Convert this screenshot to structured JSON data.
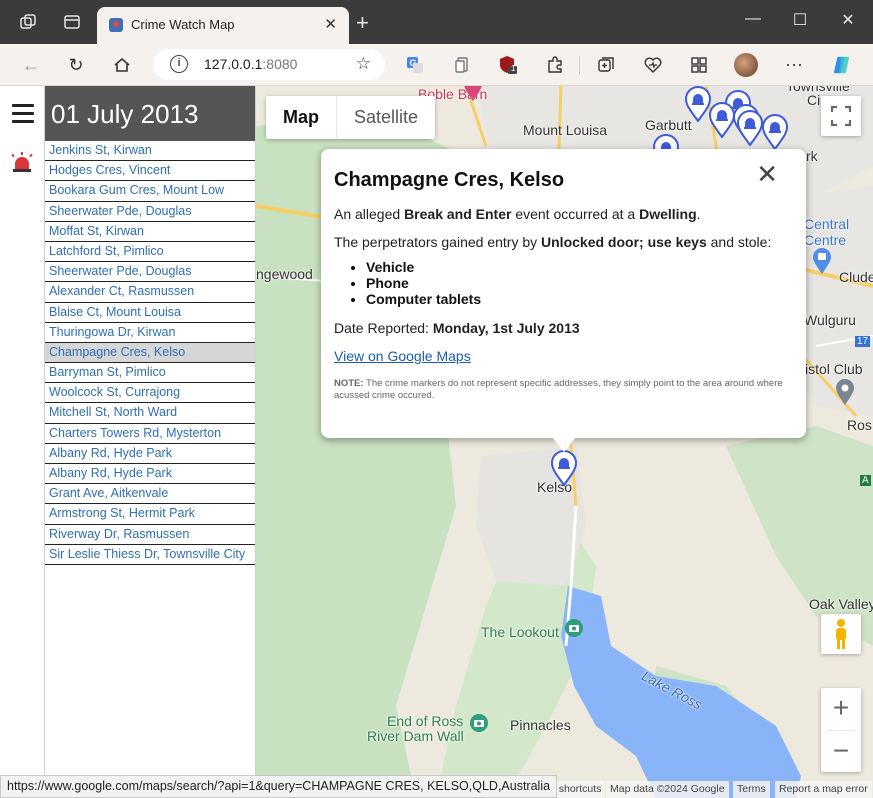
{
  "browser": {
    "tab_title": "Crime Watch Map",
    "url_host": "127.0.0.1",
    "url_port": ":8080",
    "status_url": "https://www.google.com/maps/search/?api=1&query=CHAMPAGNE CRES, KELSO,QLD,Australia",
    "extension_badge": "1"
  },
  "sidebar": {
    "date_heading": "01 July 2013",
    "selected_index": 10,
    "items": [
      "Jenkins St, Kirwan",
      "Hodges Cres, Vincent",
      "Bookara Gum Cres, Mount Low",
      "Sheerwater Pde, Douglas",
      "Moffat St, Kirwan",
      "Latchford St, Pimlico",
      "Sheerwater Pde, Douglas",
      "Alexander Ct, Rasmussen",
      "Blaise Ct, Mount Louisa",
      "Thuringowa Dr, Kirwan",
      "Champagne Cres, Kelso",
      "Barryman St, Pimlico",
      "Woolcock St, Currajong",
      "Mitchell St, North Ward",
      "Charters Towers Rd, Mysterton",
      "Albany Rd, Hyde Park",
      "Albany Rd, Hyde Park",
      "Grant Ave, Aitkenvale",
      "Armstrong St, Hermit Park",
      "Riverway Dr, Rasmussen",
      "Sir Leslie Thiess Dr, Townsville City"
    ]
  },
  "map": {
    "map_type_map": "Map",
    "map_type_satellite": "Satellite",
    "zoom_in": "+",
    "zoom_out": "−",
    "labels": {
      "boble_barn": "Boble Barn",
      "mount_louisa": "Mount Louisa",
      "garbutt": "Garbutt",
      "townsville_city": "Townsville",
      "townsville_city2": "Ci",
      "rk": "rk",
      "central": "Central",
      "centre": "Centre",
      "clude": "Clude",
      "wulguru": "Wulguru",
      "istol_club": "istol Club",
      "ros": "Ros",
      "ngewood": "ngewood",
      "kelso": "Kelso",
      "the_lookout": "The Lookout",
      "lake_ross": "Lake Ross",
      "oak_valley": "Oak Valley",
      "end_of_ross": "End of Ross",
      "river_dam_wall": "River Dam Wall",
      "pinnacles": "Pinnacles",
      "road_17": "17",
      "road_a": "A"
    },
    "attribution": {
      "shortcuts": "d shortcuts",
      "map_data": "Map data ©2024 Google",
      "terms": "Terms",
      "report": "Report a map error"
    }
  },
  "popup": {
    "title": "Champagne Cres, Kelso",
    "line1_pre": "An alleged ",
    "event": "Break and Enter",
    "line1_mid": " event occurred at a ",
    "premises": "Dwelling",
    "line1_end": ".",
    "line2_pre": "The perpetrators gained entry by ",
    "entry": "Unlocked door; use keys",
    "line2_end": " and stole:",
    "stolen": [
      "Vehicle",
      "Phone",
      "Computer tablets"
    ],
    "date_label": "Date Reported: ",
    "date_value": "Monday, 1st July 2013",
    "link": "View on Google Maps",
    "note_label": "NOTE:",
    "note_text": " The crime markers do not represent specific addresses, they simply point to the area around where acussed crime occured."
  },
  "colors": {
    "marker": "#3d5bd9",
    "list_link": "#2f6fb3",
    "selected_row": "#d6d6d6",
    "date_header_bg": "#555555",
    "water": "#8ab4f8",
    "park": "#c8e1c0"
  }
}
